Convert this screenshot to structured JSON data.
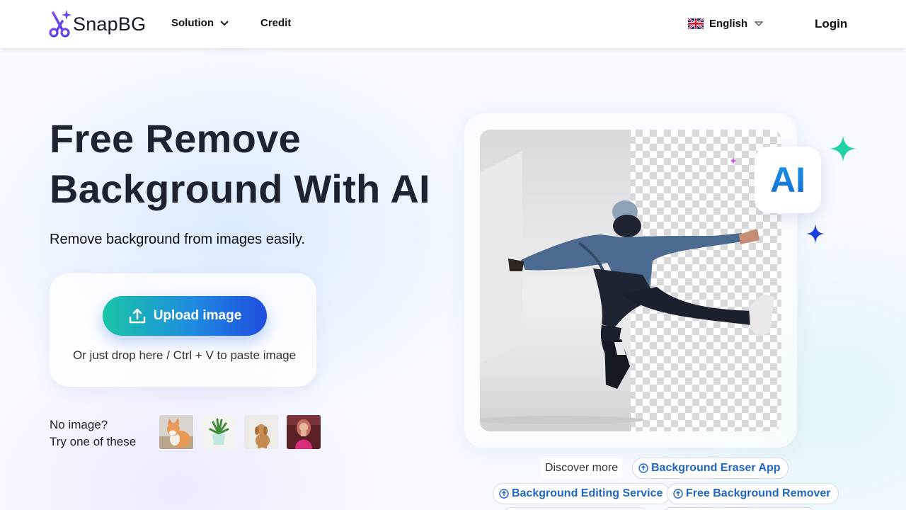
{
  "header": {
    "brand": "SnapBG",
    "nav": {
      "solution": "Solution",
      "credit": "Credit"
    },
    "language": "English",
    "login": "Login"
  },
  "hero": {
    "title_line1": "Free Remove",
    "title_line2": "Background With AI",
    "subtitle": "Remove background from images easily.",
    "upload_label": "Upload image",
    "drop_hint": "Or just drop here / Ctrl + V to paste image",
    "try_line1": "No image?",
    "try_line2": "Try one of these",
    "samples": [
      "cat",
      "plant",
      "puppy",
      "woman"
    ]
  },
  "demo": {
    "badge": "AI"
  },
  "discover": {
    "label": "Discover more",
    "links": [
      "Background Eraser App",
      "Background Editing Service",
      "Free Background Remover"
    ]
  },
  "colors": {
    "accent_blue": "#1e4ddf",
    "accent_teal": "#18c5a6",
    "link": "#2167c4",
    "title": "#1d2430"
  }
}
